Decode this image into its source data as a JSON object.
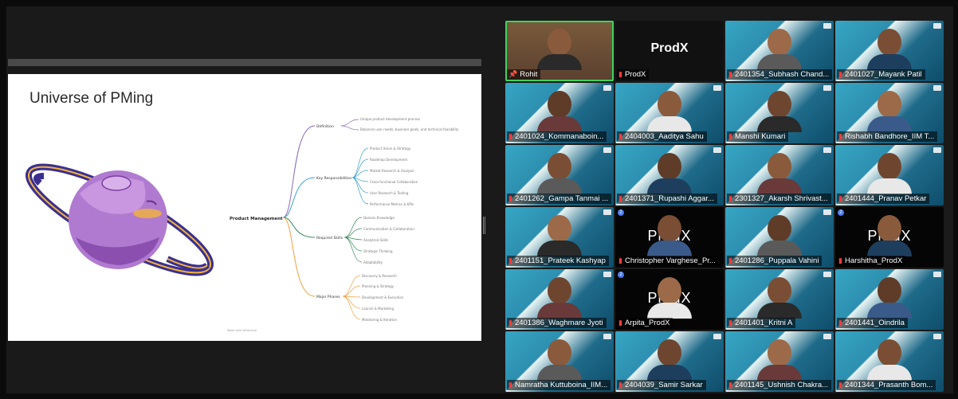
{
  "slide": {
    "title": "Universe of PMing",
    "center_label": "Product Management",
    "branches": [
      {
        "label": "Definition",
        "leaves": [
          "Unique product development process",
          "Balances user needs, business goals, and technical feasibility"
        ]
      },
      {
        "label": "Key Responsibilities",
        "leaves": [
          "Product Vision & Strategy",
          "Roadmap Development",
          "Market Research & Analysis",
          "Cross-functional Collaboration",
          "User Research & Testing",
          "Performance Metrics & KPIs"
        ]
      },
      {
        "label": "Required Skills",
        "leaves": [
          "Domain Knowledge",
          "Communication & Collaboration",
          "Analytical Skills",
          "Strategic Thinking",
          "Adaptability"
        ]
      },
      {
        "label": "Major Phases",
        "leaves": [
          "Discovery & Research",
          "Planning & Strategy",
          "Development & Execution",
          "Launch & Marketing",
          "Monitoring & Iteration"
        ]
      }
    ],
    "footer": "Made with Whimsical"
  },
  "gallery": {
    "participants": [
      {
        "name": "Rohit",
        "bg": "warm",
        "muted": false,
        "pinned": true,
        "speaking": true,
        "brand": ""
      },
      {
        "name": "ProdX",
        "bg": "dark",
        "muted": true,
        "brand": "ProdX"
      },
      {
        "name": "2401354_Subhash Chand...",
        "bg": "teal",
        "muted": true,
        "brand": ""
      },
      {
        "name": "2401027_Mayank Patil",
        "bg": "teal",
        "muted": true,
        "brand": ""
      },
      {
        "name": "2401024_Kommanaboin...",
        "bg": "teal",
        "muted": true,
        "brand": ""
      },
      {
        "name": "2404003_Aaditya Sahu",
        "bg": "teal",
        "muted": true,
        "brand": ""
      },
      {
        "name": "Manshi Kumari",
        "bg": "teal",
        "muted": true,
        "brand": ""
      },
      {
        "name": "Rishabh Bandhore_IIM T...",
        "bg": "teal",
        "muted": true,
        "brand": ""
      },
      {
        "name": "2401262_Gampa Tanmai ...",
        "bg": "teal",
        "muted": true,
        "brand": ""
      },
      {
        "name": "2401371_Rupashi Aggar...",
        "bg": "teal",
        "muted": true,
        "brand": ""
      },
      {
        "name": "2301327_Akarsh Shrivast...",
        "bg": "teal",
        "muted": true,
        "brand": ""
      },
      {
        "name": "2401444_Pranav Petkar",
        "bg": "teal",
        "muted": true,
        "brand": ""
      },
      {
        "name": "2401151_Prateek Kashyap",
        "bg": "teal",
        "muted": true,
        "brand": ""
      },
      {
        "name": "Christopher Varghese_Pr...",
        "bg": "black",
        "muted": true,
        "brand": "ProdX"
      },
      {
        "name": "2401286_Puppala Vahini",
        "bg": "teal",
        "muted": true,
        "brand": ""
      },
      {
        "name": "Harshitha_ProdX",
        "bg": "black",
        "muted": true,
        "brand": "ProdX"
      },
      {
        "name": "2401386_Waghmare Jyoti",
        "bg": "teal",
        "muted": true,
        "brand": ""
      },
      {
        "name": "Arpita_ProdX",
        "bg": "black",
        "muted": true,
        "brand": "ProdX"
      },
      {
        "name": "2401401_Kritni A",
        "bg": "teal",
        "muted": true,
        "brand": ""
      },
      {
        "name": "2401441_Oindrila",
        "bg": "teal",
        "muted": true,
        "brand": ""
      },
      {
        "name": "Namratha Kuttuboina_IIM...",
        "bg": "teal",
        "muted": true,
        "brand": ""
      },
      {
        "name": "2404039_Samir Sarkar",
        "bg": "teal",
        "muted": true,
        "brand": ""
      },
      {
        "name": "2401145_Ushnish Chakra...",
        "bg": "teal",
        "muted": true,
        "brand": ""
      },
      {
        "name": "2401344_Prasanth Bom...",
        "bg": "teal",
        "muted": true,
        "brand": ""
      }
    ]
  },
  "colors": {
    "background": "#0b0b0b",
    "active_speaker": "#3fd25f",
    "muted_icon": "#ff3b3b",
    "planet": "#a66bc9",
    "ring": "#4a3fa3",
    "ring_accent": "#f1b43a"
  },
  "icons": {
    "muted": "mic-off-icon",
    "pinned": "pin-icon"
  }
}
